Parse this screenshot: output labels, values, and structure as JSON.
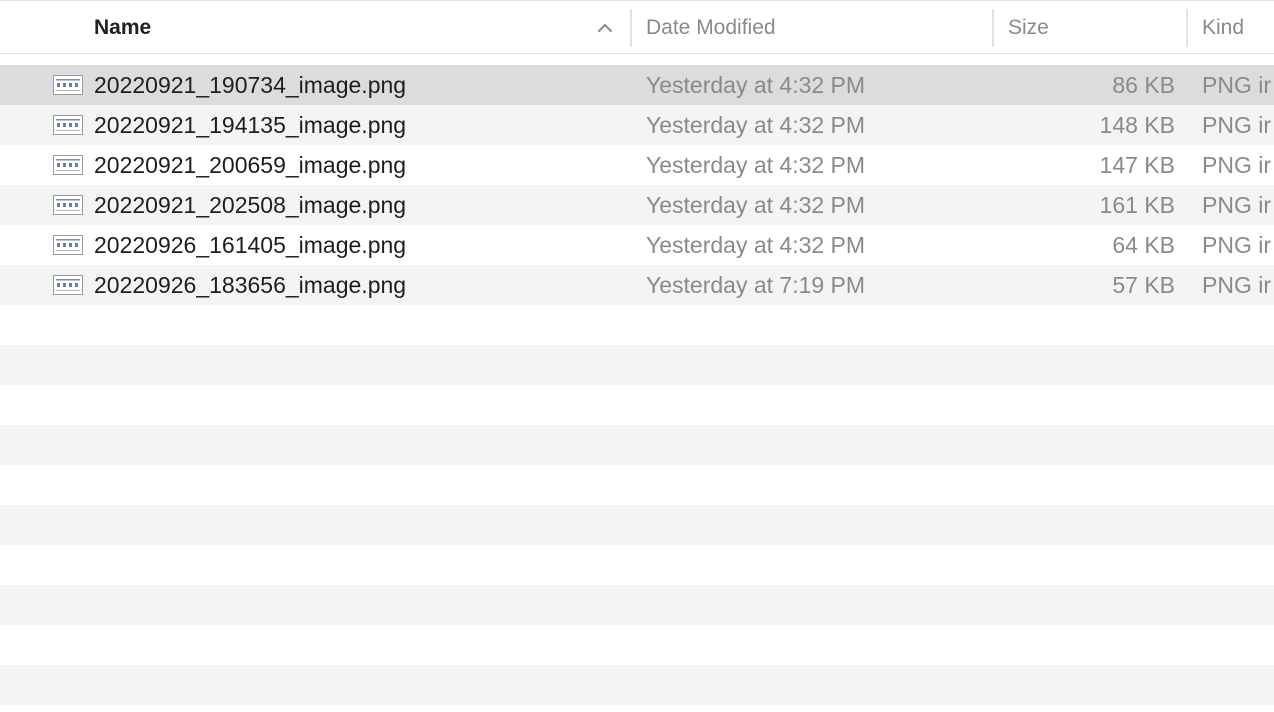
{
  "columns": {
    "name": "Name",
    "date_modified": "Date Modified",
    "size": "Size",
    "kind": "Kind"
  },
  "sort": {
    "column": "name",
    "direction": "ascending",
    "icon": "chevron-up-icon"
  },
  "files": [
    {
      "name": "20220921_190734_image.png",
      "date": "Yesterday at 4:32 PM",
      "size": "86 KB",
      "kind": "PNG ir",
      "icon": "png-file-thumbnail-icon",
      "selected": true
    },
    {
      "name": "20220921_194135_image.png",
      "date": "Yesterday at 4:32 PM",
      "size": "148 KB",
      "kind": "PNG ir",
      "icon": "png-file-thumbnail-icon",
      "selected": false
    },
    {
      "name": "20220921_200659_image.png",
      "date": "Yesterday at 4:32 PM",
      "size": "147 KB",
      "kind": "PNG ir",
      "icon": "png-file-thumbnail-icon",
      "selected": false
    },
    {
      "name": "20220921_202508_image.png",
      "date": "Yesterday at 4:32 PM",
      "size": "161 KB",
      "kind": "PNG ir",
      "icon": "png-file-thumbnail-icon",
      "selected": false
    },
    {
      "name": "20220926_161405_image.png",
      "date": "Yesterday at 4:32 PM",
      "size": "64 KB",
      "kind": "PNG ir",
      "icon": "png-file-thumbnail-icon",
      "selected": false
    },
    {
      "name": "20220926_183656_image.png",
      "date": "Yesterday at 7:19 PM",
      "size": "57 KB",
      "kind": "PNG ir",
      "icon": "png-file-thumbnail-icon",
      "selected": false
    }
  ],
  "colors": {
    "selected_row": "#dcdcdc",
    "alternate_row": "#f3f4f4",
    "primary_text": "#1e1e1e",
    "secondary_text": "#8a8a8a"
  }
}
